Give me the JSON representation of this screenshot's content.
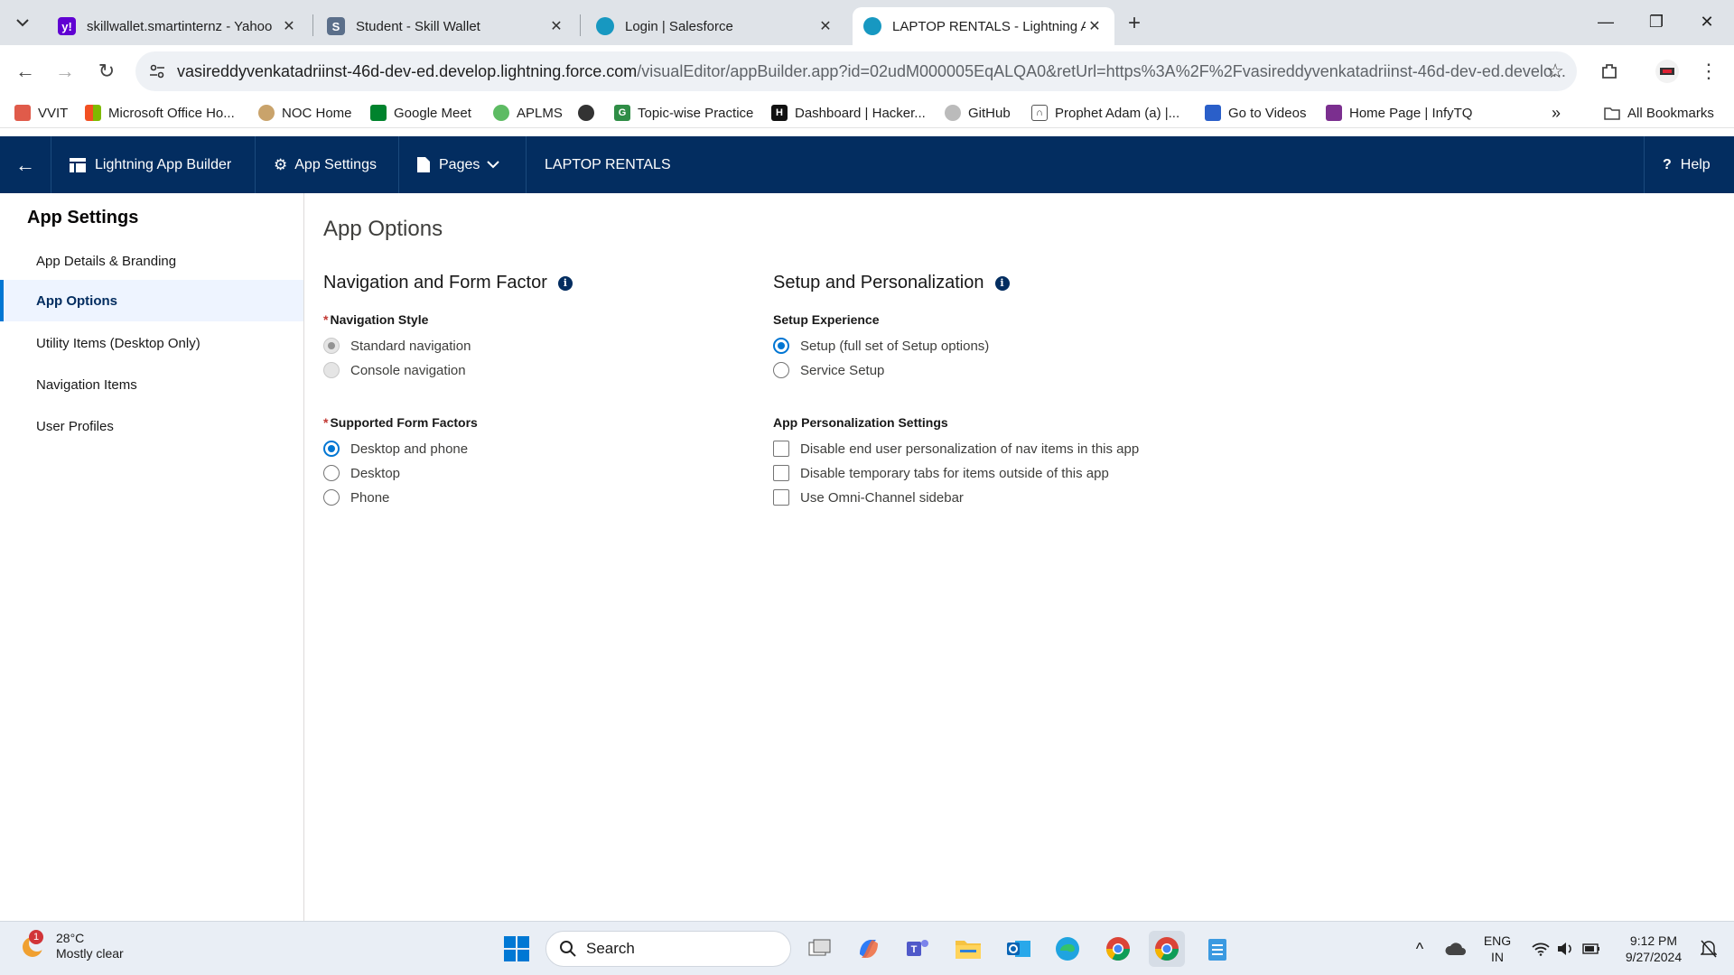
{
  "browser": {
    "tabs": [
      {
        "title": "skillwallet.smartinternz - Yahoo",
        "icon": "yahoo-icon",
        "color": "#6001d2"
      },
      {
        "title": "Student - Skill Wallet",
        "icon": "skill-wallet-icon",
        "color": "#5b6f8a"
      },
      {
        "title": "Login | Salesforce",
        "icon": "salesforce-icon",
        "color": "#1798c1"
      },
      {
        "title": "LAPTOP RENTALS - Lightning A",
        "icon": "salesforce-icon",
        "color": "#1798c1"
      }
    ],
    "url_host": "vasireddyvenkatadriinst-46d-dev-ed.develop.lightning.force.com",
    "url_path": "/visualEditor/appBuilder.app?id=02udM000005EqALQA0&retUrl=https%3A%2F%2Fvasireddyvenkatadriinst-46d-dev-ed.develo...",
    "bookmarks": [
      "VVIT",
      "Microsoft Office Ho...",
      "NOC Home",
      "Google Meet",
      "APLMS",
      "",
      "Topic-wise Practice",
      "Dashboard | Hacker...",
      "GitHub",
      "Prophet Adam (a) |...",
      "Go to Videos",
      "Home Page | InfyTQ"
    ],
    "all_bookmarks": "All Bookmarks"
  },
  "header": {
    "app_builder": "Lightning App Builder",
    "app_settings": "App Settings",
    "pages": "Pages",
    "app_name": "LAPTOP RENTALS",
    "help": "Help"
  },
  "sidebar": {
    "title": "App Settings",
    "items": [
      {
        "label": "App Details & Branding",
        "active": false
      },
      {
        "label": "App Options",
        "active": true
      },
      {
        "label": "Utility Items (Desktop Only)",
        "active": false
      },
      {
        "label": "Navigation Items",
        "active": false
      },
      {
        "label": "User Profiles",
        "active": false
      }
    ]
  },
  "main": {
    "title": "App Options",
    "nav_section": {
      "title": "Navigation and Form Factor",
      "nav_style_label": "Navigation Style",
      "nav_style_options": [
        "Standard navigation",
        "Console navigation"
      ],
      "form_factor_label": "Supported Form Factors",
      "form_factor_options": [
        "Desktop and phone",
        "Desktop",
        "Phone"
      ]
    },
    "setup_section": {
      "title": "Setup and Personalization",
      "setup_label": "Setup Experience",
      "setup_options": [
        "Setup (full set of Setup options)",
        "Service Setup"
      ],
      "personalization_label": "App Personalization Settings",
      "personalization_options": [
        "Disable end user personalization of nav items in this app",
        "Disable temporary tabs for items outside of this app",
        "Use Omni-Channel sidebar"
      ]
    }
  },
  "taskbar": {
    "temperature": "28°C",
    "weather": "Mostly clear",
    "weather_badge": "1",
    "search": "Search",
    "lang1": "ENG",
    "lang2": "IN",
    "time": "9:12 PM",
    "date": "9/27/2024"
  },
  "colors": {
    "sf_header": "#032d60",
    "accent": "#0176d3"
  }
}
